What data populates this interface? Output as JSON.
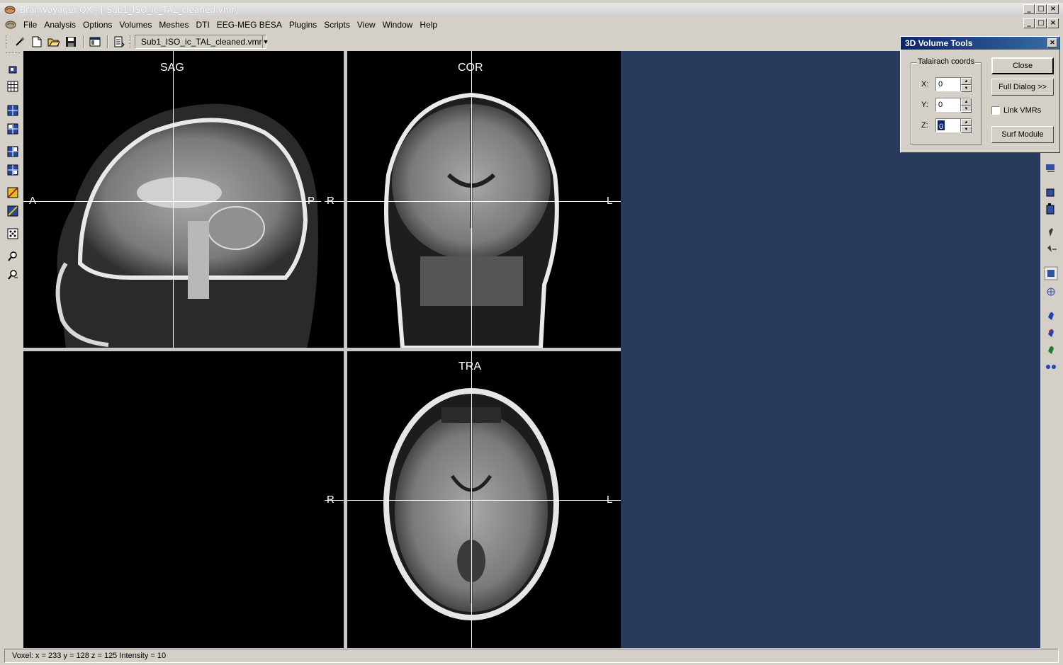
{
  "window": {
    "title": "BrainVoyager QX - [ Sub1_ISO_ic_TAL_cleaned.vmr]",
    "controls": [
      "_",
      "□",
      "×"
    ]
  },
  "menu": {
    "items": [
      "File",
      "Analysis",
      "Options",
      "Volumes",
      "Meshes",
      "DTI",
      "EEG-MEG BESA",
      "Plugins",
      "Scripts",
      "View",
      "Window",
      "Help"
    ]
  },
  "toolbar": {
    "file_combo_value": "Sub1_ISO_ic_TAL_cleaned.vmr"
  },
  "views": {
    "sagittal": {
      "label": "SAG",
      "left": "A",
      "right": "P"
    },
    "coronal": {
      "label": "COR",
      "left": "R",
      "right": "L"
    },
    "transversal": {
      "label": "TRA",
      "left": "R",
      "right": "L"
    }
  },
  "dialog": {
    "title": "3D Volume Tools",
    "group_label": "Talairach coords",
    "x_label": "X:",
    "x_value": "0",
    "y_label": "Y:",
    "y_value": "0",
    "z_label": "Z:",
    "z_value": "0",
    "close_label": "Close",
    "full_dialog_label": "Full Dialog >>",
    "link_vmrs_label": "Link VMRs",
    "surf_module_label": "Surf Module"
  },
  "status": {
    "text": "Voxel:  x = 233 y = 128 z = 125  Intensity = 10"
  },
  "colors": {
    "accent": "#0a246a",
    "viewport_bg": "#000000",
    "dark_area": "#2a3a5c",
    "chrome": "#d4d0c8"
  }
}
